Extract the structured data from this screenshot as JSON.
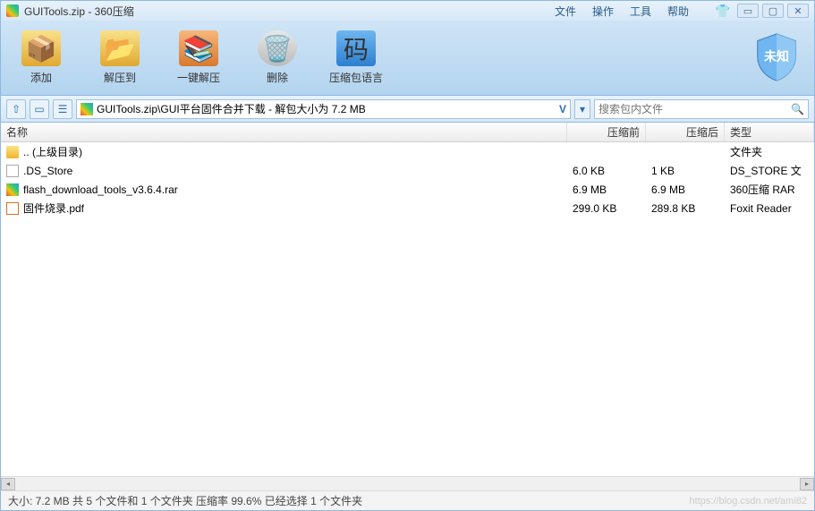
{
  "title": "GUITools.zip - 360压缩",
  "menu": {
    "file": "文件",
    "operation": "操作",
    "tools": "工具",
    "help": "帮助"
  },
  "toolbar": {
    "add": "添加",
    "extract": "解压到",
    "oneclick": "一键解压",
    "delete": "删除",
    "lang": "压缩包语言"
  },
  "shield": "未知",
  "path": "GUITools.zip\\GUI平台固件合并下载 - 解包大小为 7.2 MB",
  "search_placeholder": "搜索包内文件",
  "columns": {
    "name": "名称",
    "before": "压缩前",
    "after": "压缩后",
    "type": "类型"
  },
  "files": [
    {
      "icon": "folder",
      "name": ".. (上级目录)",
      "before": "",
      "after": "",
      "type": "文件夹"
    },
    {
      "icon": "file",
      "name": ".DS_Store",
      "before": "6.0 KB",
      "after": "1 KB",
      "type": "DS_STORE 文"
    },
    {
      "icon": "rar",
      "name": "flash_download_tools_v3.6.4.rar",
      "before": "6.9 MB",
      "after": "6.9 MB",
      "type": "360压缩 RAR"
    },
    {
      "icon": "pdf",
      "name": "固件烧录.pdf",
      "before": "299.0 KB",
      "after": "289.8 KB",
      "type": "Foxit Reader"
    }
  ],
  "status": "大小: 7.2 MB 共 5 个文件和 1 个文件夹 压缩率 99.6% 已经选择 1 个文件夹",
  "watermark": "https://blog.csdn.net/ami82"
}
